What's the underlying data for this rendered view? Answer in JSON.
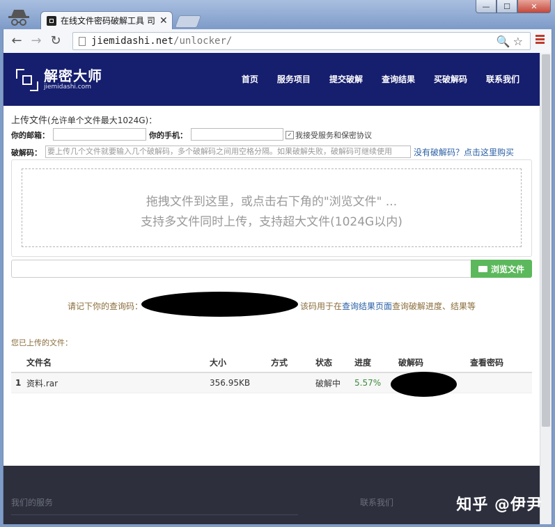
{
  "browser": {
    "tab_title": "在线文件密码破解工具 司",
    "tab_close": "✕",
    "url_host": "jiemidashi.net",
    "url_path": "/unlocker/",
    "win_min": "—",
    "win_max": "☐",
    "win_close": "✕",
    "back": "←",
    "forward": "→",
    "reload": "↻",
    "omni_tools": "🔍☆"
  },
  "site": {
    "logo_cn": "解密大师",
    "logo_en": "jiemidashi.com",
    "nav": [
      "首页",
      "服务项目",
      "提交破解",
      "查询结果",
      "买破解码",
      "联系我们"
    ]
  },
  "form": {
    "upload_title": "上传文件",
    "upload_hint": "(允许单个文件最大1024G)：",
    "email_label": "你的邮箱：",
    "phone_label": "你的手机：",
    "agree_label": "我接受服务和保密协议",
    "agree_check": "✓",
    "code_label": "破解码：",
    "code_placeholder": "要上传几个文件就要输入几个破解码，多个破解码之间用空格分隔。如果破解失败，破解码可继续使用",
    "buy_link": "没有破解码？点击这里购买",
    "drop_line1": "拖拽文件到这里，或点击右下角的\"浏览文件\" ...",
    "drop_line2": "支持多文件同时上传，支持超大文件(1024G以内)",
    "browse_btn": "浏览文件"
  },
  "query": {
    "prefix": "请记下你的查询码：",
    "suffix_before": "该码用于在",
    "suffix_link": "查询结果页面",
    "suffix_after": "查询破解进度、结果等"
  },
  "uploaded": {
    "label": "您已上传的文件：",
    "columns": [
      "",
      "文件名",
      "大小",
      "方式",
      "状态",
      "进度",
      "破解码",
      "查看密码"
    ],
    "rows": [
      {
        "index": "1",
        "name": "资料.rar",
        "size": "356.95KB",
        "method": "",
        "status": "破解中",
        "progress": "5.57%",
        "code": "",
        "password": ""
      }
    ]
  },
  "footer": {
    "services": "我们的服务",
    "contact": "联系我们"
  },
  "watermark": "知乎 @伊尹"
}
